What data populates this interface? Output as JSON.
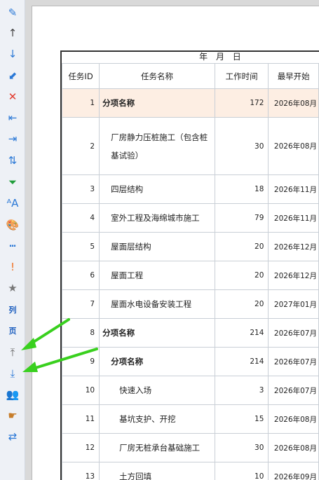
{
  "toolbar": {
    "items": [
      {
        "name": "edit-pen-icon",
        "glyph": "✎",
        "color": "#2a78d6"
      },
      {
        "name": "move-up-icon",
        "glyph": "↑",
        "color": "#444"
      },
      {
        "name": "move-down-icon",
        "glyph": "↓",
        "color": "#2a78d6"
      },
      {
        "name": "arrow-down-left-icon",
        "glyph": "⬋",
        "color": "#2a78d6"
      },
      {
        "name": "delete-icon",
        "glyph": "✕",
        "color": "#e23b2e"
      },
      {
        "name": "outdent-icon",
        "glyph": "⇤",
        "color": "#2a78d6"
      },
      {
        "name": "indent-icon",
        "glyph": "⇥",
        "color": "#2a78d6"
      },
      {
        "name": "sort-icon",
        "glyph": "⇅",
        "color": "#2a78d6"
      },
      {
        "name": "filter-icon",
        "glyph": "⏷",
        "color": "#1f9d3a"
      },
      {
        "name": "font-icon",
        "glyph": "ᴬA",
        "color": "#2a78d6"
      },
      {
        "name": "palette-icon",
        "glyph": "🎨",
        "color": "#c03"
      },
      {
        "name": "line-style-icon",
        "glyph": "┅",
        "color": "#2a78d6"
      },
      {
        "name": "important-icon",
        "glyph": "!",
        "color": "#f07020"
      },
      {
        "name": "star-icon",
        "glyph": "★",
        "color": "#777"
      },
      {
        "name": "column-label-icon",
        "glyph": "列",
        "color": "#1d5fbf"
      },
      {
        "name": "page-label-icon",
        "glyph": "页",
        "color": "#1d5fbf"
      },
      {
        "name": "move-to-top-icon",
        "glyph": "⤒",
        "color": "#666"
      },
      {
        "name": "move-to-bottom-icon",
        "glyph": "⤓",
        "color": "#2a78d6"
      },
      {
        "name": "users-icon",
        "glyph": "👥",
        "color": "#1f9d3a"
      },
      {
        "name": "pointing-hand-icon",
        "glyph": "☛",
        "color": "#c77d2a"
      },
      {
        "name": "swap-icon",
        "glyph": "⇄",
        "color": "#2a78d6"
      }
    ]
  },
  "date_header": "年 月 日",
  "table": {
    "headers": {
      "id": "任务ID",
      "name": "任务名称",
      "duration": "工作时间",
      "start": "最早开始"
    },
    "rows": [
      {
        "id": "1",
        "name": "分项名称",
        "duration": "172",
        "start": "2026年08月",
        "bold": true,
        "highlight": true,
        "indent": 0,
        "lines": 1
      },
      {
        "id": "2",
        "name": "厂房静力压桩施工（包含桩基试验）",
        "duration": "30",
        "start": "2026年08月",
        "bold": false,
        "highlight": false,
        "indent": 1,
        "lines": 3
      },
      {
        "id": "3",
        "name": "四层结构",
        "duration": "18",
        "start": "2026年11月",
        "bold": false,
        "highlight": false,
        "indent": 1,
        "lines": 1
      },
      {
        "id": "4",
        "name": "室外工程及海绵城市施工",
        "duration": "79",
        "start": "2026年11月",
        "bold": false,
        "highlight": false,
        "indent": 1,
        "lines": 1
      },
      {
        "id": "5",
        "name": "屋面层结构",
        "duration": "20",
        "start": "2026年12月",
        "bold": false,
        "highlight": false,
        "indent": 1,
        "lines": 1
      },
      {
        "id": "6",
        "name": "屋面工程",
        "duration": "20",
        "start": "2026年12月",
        "bold": false,
        "highlight": false,
        "indent": 1,
        "lines": 1
      },
      {
        "id": "7",
        "name": "屋面水电设备安装工程",
        "duration": "20",
        "start": "2027年01月",
        "bold": false,
        "highlight": false,
        "indent": 1,
        "lines": 1
      },
      {
        "id": "8",
        "name": "分项名称",
        "duration": "214",
        "start": "2026年07月",
        "bold": true,
        "highlight": false,
        "indent": 0,
        "lines": 1
      },
      {
        "id": "9",
        "name": "分项名称",
        "duration": "214",
        "start": "2026年07月",
        "bold": true,
        "highlight": false,
        "indent": 1,
        "lines": 1
      },
      {
        "id": "10",
        "name": "快速入场",
        "duration": "3",
        "start": "2026年07月",
        "bold": false,
        "highlight": false,
        "indent": 2,
        "lines": 1
      },
      {
        "id": "11",
        "name": "基坑支护、开挖",
        "duration": "15",
        "start": "2026年08月",
        "bold": false,
        "highlight": false,
        "indent": 2,
        "lines": 1
      },
      {
        "id": "12",
        "name": "厂房无桩承台基础施工",
        "duration": "30",
        "start": "2026年08月",
        "bold": false,
        "highlight": false,
        "indent": 2,
        "lines": 1
      },
      {
        "id": "13",
        "name": "土方回填",
        "duration": "10",
        "start": "2026年09月",
        "bold": false,
        "highlight": false,
        "indent": 2,
        "lines": 1
      }
    ]
  }
}
